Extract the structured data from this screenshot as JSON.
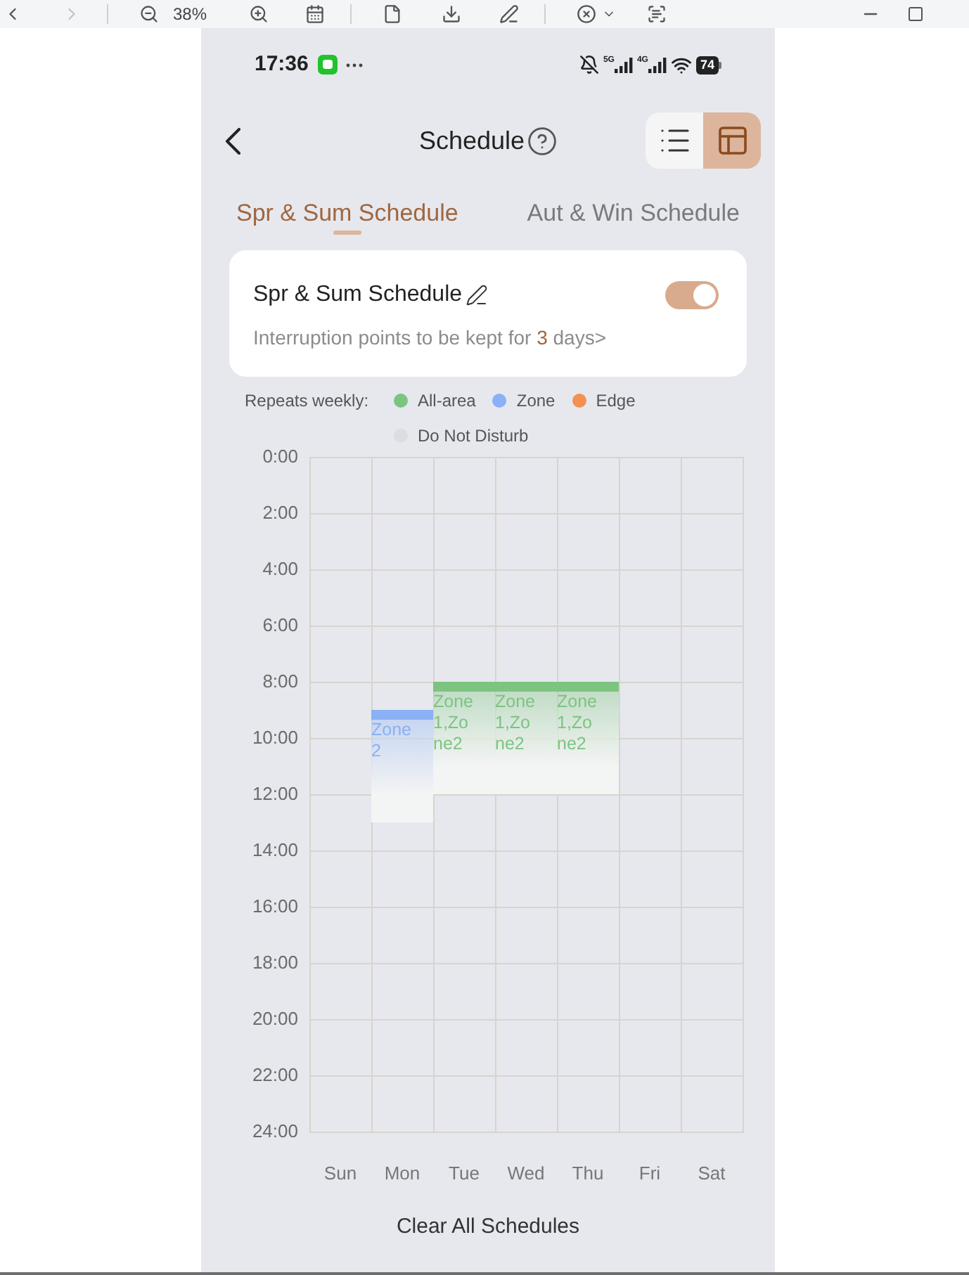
{
  "browser_toolbar": {
    "zoom": "38%",
    "forward_disabled": true
  },
  "status_bar": {
    "time": "17:36",
    "networks": [
      "5G",
      "4G"
    ],
    "battery": "74"
  },
  "header": {
    "title": "Schedule",
    "view_modes": [
      {
        "kind": "list",
        "selected": false
      },
      {
        "kind": "calendar",
        "selected": true
      }
    ]
  },
  "tabs": [
    {
      "label": "Spr & Sum Schedule",
      "selected": true
    },
    {
      "label": "Aut & Win Schedule",
      "selected": false
    }
  ],
  "card": {
    "title": "Spr & Sum Schedule",
    "on": true,
    "retention_before": "Interruption points to be kept for ",
    "retention_value": "3",
    "retention_after": " days>"
  },
  "legend": {
    "label": "Repeats weekly:",
    "items": [
      {
        "label": "All-area",
        "color": "#7cc47f"
      },
      {
        "label": "Zone",
        "color": "#8ab0f5"
      },
      {
        "label": "Edge",
        "color": "#f39150"
      },
      {
        "label": "Do Not Disturb",
        "color": "#dcdde1"
      }
    ]
  },
  "schedule": {
    "hours": [
      "0:00",
      "2:00",
      "4:00",
      "6:00",
      "8:00",
      "10:00",
      "12:00",
      "14:00",
      "16:00",
      "18:00",
      "20:00",
      "22:00",
      "24:00"
    ],
    "days": [
      {
        "label": "Sun"
      },
      {
        "label": "Mon",
        "blocks": [
          {
            "label": "Zone 2",
            "color": "#8ab0f5"
          }
        ]
      },
      {
        "label": "Tue",
        "blocks": [
          {
            "label": "Zone 1,Zone2",
            "color": "#7cc47f"
          }
        ]
      },
      {
        "label": "Wed",
        "blocks": [
          {
            "label": "Zone 1,Zone2",
            "color": "#7cc47f"
          }
        ]
      },
      {
        "label": "Thu",
        "blocks": [
          {
            "label": "Zone 1,Zone2",
            "color": "#7cc47f"
          }
        ]
      },
      {
        "label": "Fri"
      },
      {
        "label": "Sat"
      }
    ]
  },
  "clear_button": "Clear All Schedules"
}
